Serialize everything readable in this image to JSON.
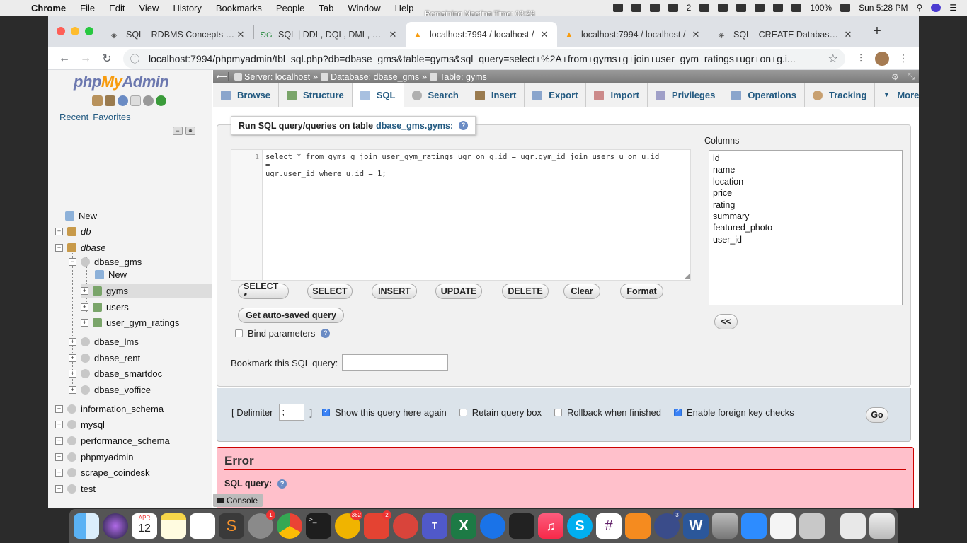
{
  "menubar": {
    "app": "Chrome",
    "menus": [
      "File",
      "Edit",
      "View",
      "History",
      "Bookmarks",
      "People",
      "Tab",
      "Window",
      "Help"
    ],
    "meeting_overlay": "Remaining Meeting Time: 03:23",
    "badge_count": "2",
    "battery": "100%",
    "clock": "Sun 5:28 PM"
  },
  "browser": {
    "tabs": [
      {
        "label": "SQL - RDBMS Concepts - Tu",
        "icon": "globe-icon"
      },
      {
        "label": "SQL | DDL, DQL, DML, DCL",
        "icon": "gg-icon"
      },
      {
        "label": "localhost:7994 / localhost /",
        "icon": "pma-icon"
      },
      {
        "label": "localhost:7994 / localhost /",
        "icon": "pma-icon"
      },
      {
        "label": "SQL - CREATE Database - T",
        "icon": "globe-icon"
      }
    ],
    "url": "localhost:7994/phpmyadmin/tbl_sql.php?db=dbase_gms&table=gyms&sql_query=select+%2A+from+gyms+g+join+user_gym_ratings+ugr+on+g.i..."
  },
  "nav": {
    "logo_php": "php",
    "logo_my": "My",
    "logo_admin": "Admin",
    "recent": "Recent",
    "favorites": "Favorites",
    "tree": {
      "new_root": "New",
      "db": "db",
      "dbase": "dbase",
      "dbase_gms": "dbase_gms",
      "new_gms": "New",
      "gyms": "gyms",
      "users": "users",
      "user_gym_ratings": "user_gym_ratings",
      "dbase_lms": "dbase_lms",
      "dbase_rent": "dbase_rent",
      "dbase_smartdoc": "dbase_smartdoc",
      "dbase_voffice": "dbase_voffice",
      "information_schema": "information_schema",
      "mysql": "mysql",
      "performance_schema": "performance_schema",
      "phpmyadmin": "phpmyadmin",
      "scrape_coindesk": "scrape_coindesk",
      "test": "test"
    }
  },
  "breadcrumb": {
    "server": "Server: localhost",
    "database": "Database: dbase_gms",
    "table": "Table: gyms",
    "sep": "»"
  },
  "tabs": [
    "Browse",
    "Structure",
    "SQL",
    "Search",
    "Insert",
    "Export",
    "Import",
    "Privileges",
    "Operations",
    "Tracking",
    "More"
  ],
  "sql": {
    "legend": "Run SQL query/queries on table",
    "table_name": "dbase_gms.gyms:",
    "line_number": "1",
    "query_line1": "select * from gyms g join user_gym_ratings ugr on g.id = ugr.gym_id join users u on u.id =",
    "query_line2": "ugr.user_id where u.id = 1;",
    "buttons": [
      "SELECT *",
      "SELECT",
      "INSERT",
      "UPDATE",
      "DELETE",
      "Clear",
      "Format"
    ],
    "autosave": "Get auto-saved query",
    "bind_params": "Bind parameters",
    "bookmark_label": "Bookmark this SQL query:",
    "bookmark_value": "",
    "columns_label": "Columns",
    "columns": [
      "id",
      "name",
      "location",
      "price",
      "rating",
      "summary",
      "featured_photo",
      "user_id"
    ],
    "insert_col_btn": "<<"
  },
  "options": {
    "delimiter_open": "[ Delimiter",
    "delimiter_value": ";",
    "delimiter_close": "]",
    "show_again": "Show this query here again",
    "show_again_checked": true,
    "retain": "Retain query box",
    "retain_checked": false,
    "rollback": "Rollback when finished",
    "rollback_checked": false,
    "foreign": "Enable foreign key checks",
    "foreign_checked": true,
    "go": "Go"
  },
  "error": {
    "title": "Error",
    "sql_query_label": "SQL query:"
  },
  "console": "Console",
  "dock": {
    "calendar_month": "APR",
    "calendar_day": "12",
    "badges": {
      "sysprefs": "1",
      "outlook": "362",
      "todoist": "2",
      "slack": "",
      "vlc": "3"
    }
  }
}
